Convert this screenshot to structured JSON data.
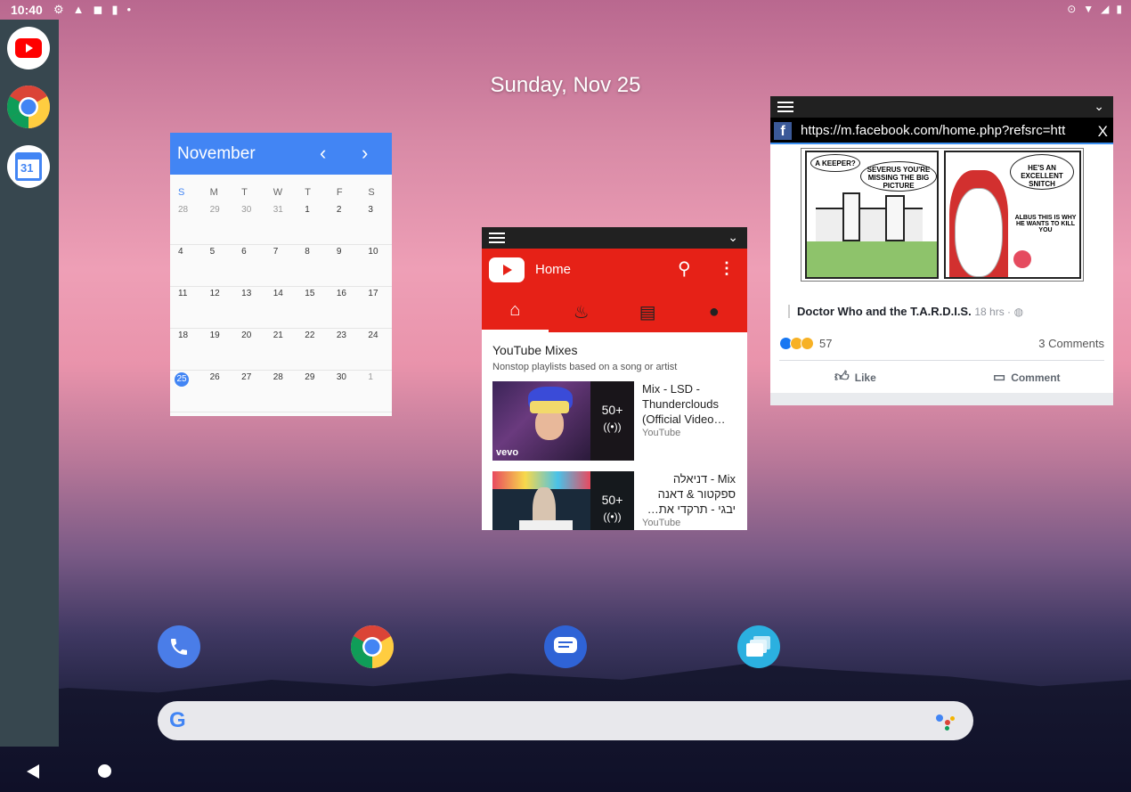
{
  "status_bar": {
    "time": "10:40"
  },
  "home": {
    "date": "Sunday, Nov 25"
  },
  "side_dock": {
    "apps": [
      {
        "name": "YouTube",
        "icon": "youtube-icon"
      },
      {
        "name": "Chrome",
        "icon": "chrome-icon"
      },
      {
        "name": "Calendar",
        "icon": "calendar-icon",
        "badge": "31"
      }
    ]
  },
  "calendar_widget": {
    "month": "November",
    "prev": "‹",
    "next": "›",
    "weekdays": [
      "S",
      "M",
      "T",
      "W",
      "T",
      "F",
      "S"
    ],
    "weeks": [
      [
        "28",
        "29",
        "30",
        "31",
        "1",
        "2",
        "3"
      ],
      [
        "4",
        "5",
        "6",
        "7",
        "8",
        "9",
        "10"
      ],
      [
        "11",
        "12",
        "13",
        "14",
        "15",
        "16",
        "17"
      ],
      [
        "18",
        "19",
        "20",
        "21",
        "22",
        "23",
        "24"
      ],
      [
        "25",
        "26",
        "27",
        "28",
        "29",
        "30",
        "1"
      ]
    ],
    "today": "25",
    "accent": "#4285f4"
  },
  "youtube_window": {
    "title": "Home",
    "section_title": "YouTube Mixes",
    "section_subtitle": "Nonstop playlists based on a song or artist",
    "items": [
      {
        "title": "Mix - LSD - Thunderclouds (Official Video…",
        "channel": "YouTube",
        "count": "50+",
        "thumb_label": "vevo"
      },
      {
        "title": "Mix - דניאלה ספקטור & דאנה יבגי - תרקדי את…",
        "channel": "YouTube",
        "count": "50+"
      }
    ],
    "accent": "#e62117"
  },
  "facebook_window": {
    "url": "https://m.facebook.com/home.php?refsrc=htt",
    "close": "X",
    "comic": {
      "bubble1": "A KEEPER?",
      "bubble2": "SEVERUS YOU'RE MISSING THE BIG PICTURE",
      "bubble3": "HE'S AN EXCELLENT SNITCH",
      "caption": "ALBUS THIS IS WHY HE WANTS TO KILL YOU"
    },
    "post_title": "Doctor Who and the T.A.R.D.I.S.",
    "post_time": "18 hrs ·",
    "reactions": "57",
    "comments": "3 Comments",
    "like_label": "Like",
    "comment_label": "Comment"
  },
  "hotseat": [
    {
      "name": "Phone",
      "icon": "phone-icon"
    },
    {
      "name": "Chrome",
      "icon": "chrome-icon"
    },
    {
      "name": "Messages",
      "icon": "messages-icon"
    },
    {
      "name": "Recents",
      "icon": "windows-icon"
    }
  ],
  "search_bar": {
    "logo": "G"
  }
}
